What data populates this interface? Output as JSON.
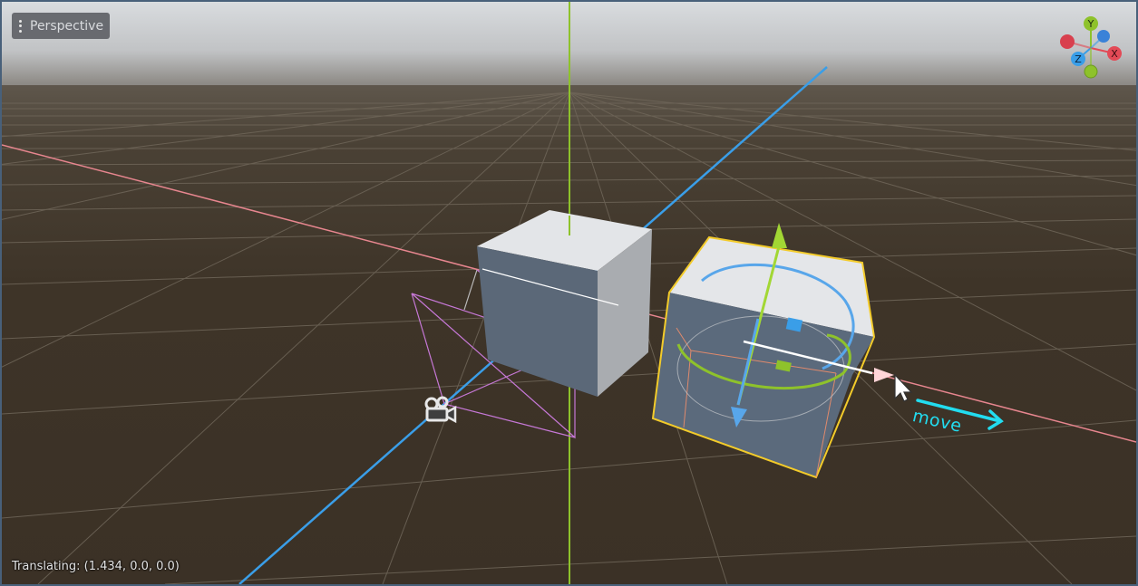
{
  "viewport": {
    "view_menu_label": "Perspective",
    "status": "Translating: (1.434, 0.0, 0.0)"
  },
  "gizmo": {
    "y_label": "Y",
    "x_label": "X",
    "z_label": "Z",
    "colors": {
      "x": "#e34a56",
      "y": "#8ec22b",
      "z": "#3a9ee8"
    }
  },
  "annotation": {
    "move_label": "move",
    "color": "#22dcef"
  },
  "icons": [
    "kebab-menu-icon",
    "camera-icon",
    "mouse-cursor-icon"
  ]
}
